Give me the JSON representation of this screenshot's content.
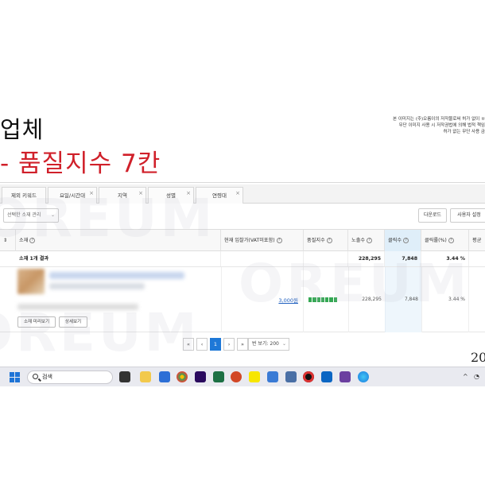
{
  "slide": {
    "title_line1": "업체",
    "title_line2": "- 품질지수 7칸",
    "copyright_notice": [
      "본 이미지는 (주)오름이의 저작물로써 허가 없이 ㅂ",
      "무단 이미지 사용 시 저작권법에 의해 법적 책임",
      "허가 없는 무단 사용 금"
    ],
    "page_number": "20"
  },
  "tabs": [
    {
      "label": "제외 키워드"
    },
    {
      "label": "요일/시간대"
    },
    {
      "label": "지역"
    },
    {
      "label": "성별"
    },
    {
      "label": "연령대"
    }
  ],
  "toolbar": {
    "select_placeholder": "선택한 소재 관리",
    "download_label": "다운로드",
    "user_setting_label": "사용자 설정"
  },
  "table": {
    "headers": {
      "ad": "소재",
      "bid": "현재 입찰가(VAT미포함)",
      "quality": "품질지수",
      "impressions": "노출수",
      "clicks": "클릭수",
      "ctr": "클릭률(%)",
      "avg": "평균"
    },
    "summary": {
      "label": "소재 1개 결과",
      "impressions": "228,295",
      "clicks": "7,848",
      "ctr": "3.44 %"
    },
    "row": {
      "bid": "3,000원",
      "quality_level": 7,
      "impressions": "228,295",
      "clicks": "7,848",
      "ctr": "3.44 %",
      "preview_button": "소재 미리보기",
      "detail_button": "상세보기"
    }
  },
  "pagination": {
    "first": "«",
    "prev": "‹",
    "current": "1",
    "next": "›",
    "last": "»",
    "per_page": "번 보기: 200"
  },
  "taskbar": {
    "search_label": "검색"
  },
  "watermark": "OREUM"
}
